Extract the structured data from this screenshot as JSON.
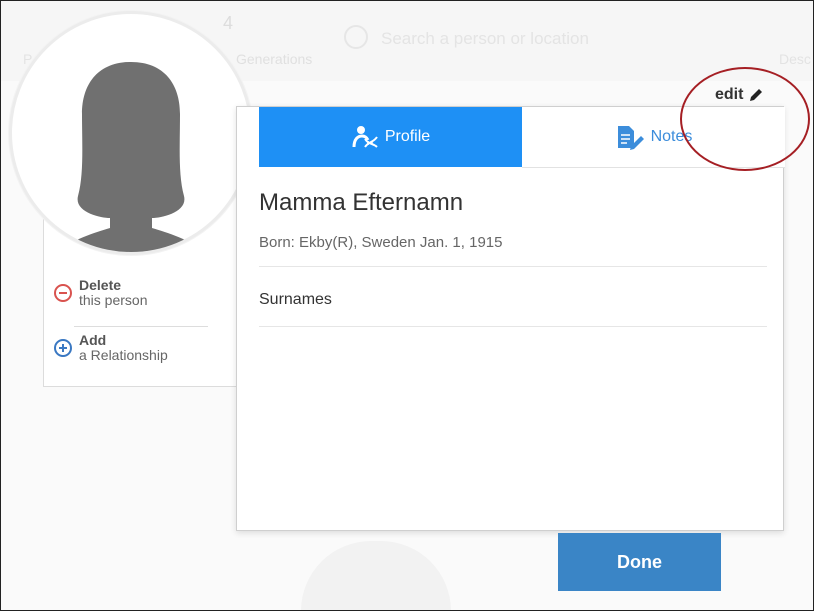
{
  "background": {
    "generations_count": "4",
    "generations_label": "Generations",
    "search_placeholder": "Search a person or location",
    "left_label": "P",
    "right_label": "Desc"
  },
  "actions": {
    "delete_title": "Delete",
    "delete_sub": "this person",
    "add_title": "Add",
    "add_sub": "a Relationship"
  },
  "edit": {
    "label": "edit"
  },
  "tabs": [
    {
      "label": "Profile",
      "icon": "dna-person-icon",
      "active": true
    },
    {
      "label": "Notes",
      "icon": "notes-pencil-icon",
      "active": false
    }
  ],
  "person": {
    "name": "Mamma Efternamn",
    "born": "Born: Ekby(R), Sweden Jan. 1, 1915",
    "surnames_label": "Surnames"
  },
  "done_label": "Done",
  "colors": {
    "tab_active": "#1e90f5",
    "done_button": "#3a85c6",
    "highlight": "#a51f24",
    "delete": "#d9534f",
    "add": "#3a78c2"
  }
}
